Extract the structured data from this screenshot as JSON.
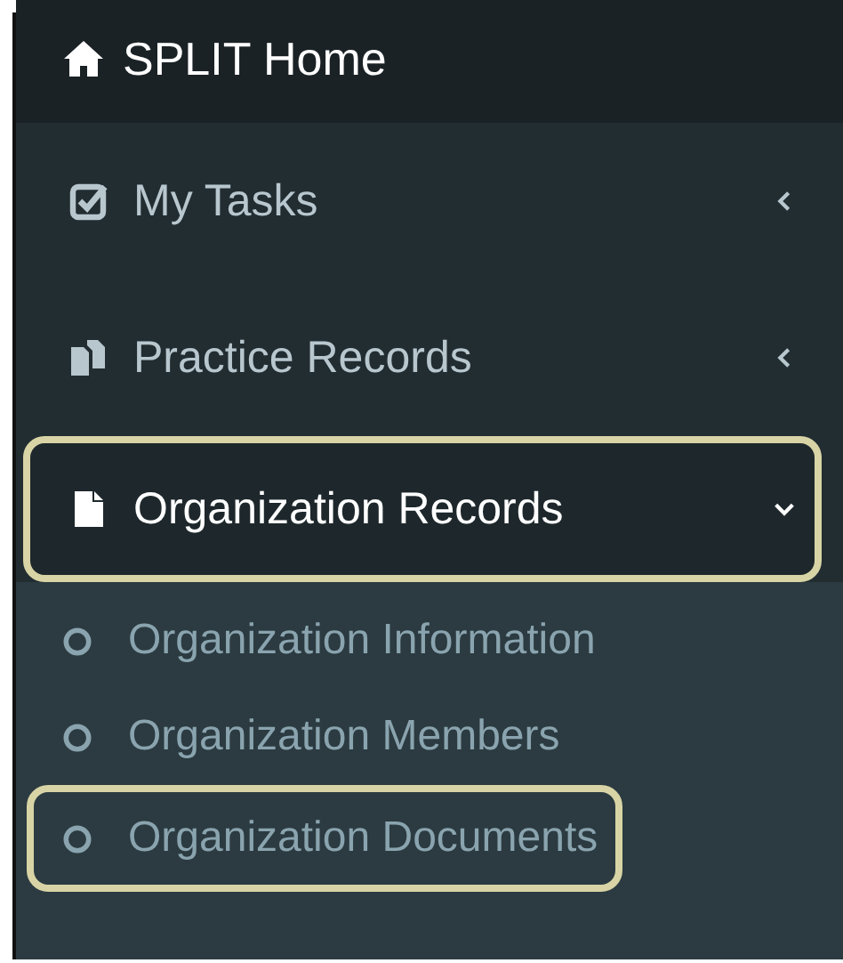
{
  "header": {
    "title": "SPLIT Home"
  },
  "menu": [
    {
      "label": "My Tasks",
      "expanded": false,
      "highlighted": false
    },
    {
      "label": "Practice Records",
      "expanded": false,
      "highlighted": false
    },
    {
      "label": "Organization Records",
      "expanded": true,
      "highlighted": true,
      "children": [
        {
          "label": "Organization Information",
          "highlighted": false
        },
        {
          "label": "Organization Members",
          "highlighted": false
        },
        {
          "label": "Organization Documents",
          "highlighted": true
        }
      ]
    }
  ]
}
